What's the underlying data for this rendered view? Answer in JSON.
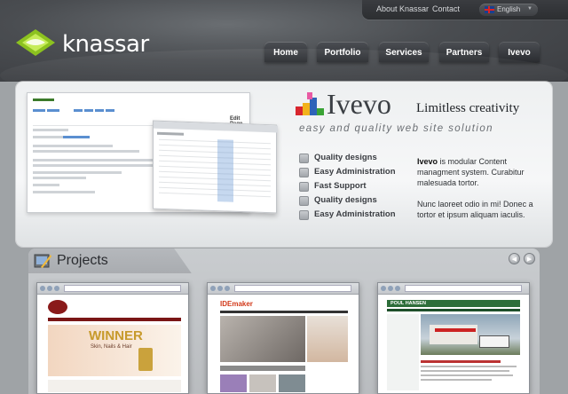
{
  "header": {
    "top_links": [
      "About Knassar",
      "Contact"
    ],
    "language": "English",
    "brand": "knassar",
    "nav": [
      {
        "label": "Home"
      },
      {
        "label": "Portfolio"
      },
      {
        "label": "Services"
      },
      {
        "label": "Partners"
      },
      {
        "label": "Ivevo"
      }
    ]
  },
  "hero": {
    "product_name": "Ivevo",
    "tagline": "Limitless creativity",
    "subtagline": "easy and quality web site solution",
    "features": [
      "Quality designs",
      "Easy Administration",
      "Fast Support",
      "Quality designs",
      "Easy Administration"
    ],
    "description_bold": "Ivevo",
    "description_rest": " is modular Content managment system.  Curabitur malesuada tortor.",
    "description2": "Nunc laoreet odio in mi! Donec a tortor et ipsum aliquam iaculis.",
    "screenshot_heading": "Edit Page"
  },
  "projects": {
    "title": "Projects",
    "thumb1": {
      "headline": "WINNER",
      "sub": "Skin, Nails & Hair"
    },
    "thumb2": {
      "logo": "IDEmaker"
    },
    "thumb3": {
      "logo": "POUL HANSEN"
    }
  },
  "colors": {
    "logo_green": "#9fd12a",
    "header_dark": "#3a3c40",
    "link_blue": "#5b8fd0"
  }
}
